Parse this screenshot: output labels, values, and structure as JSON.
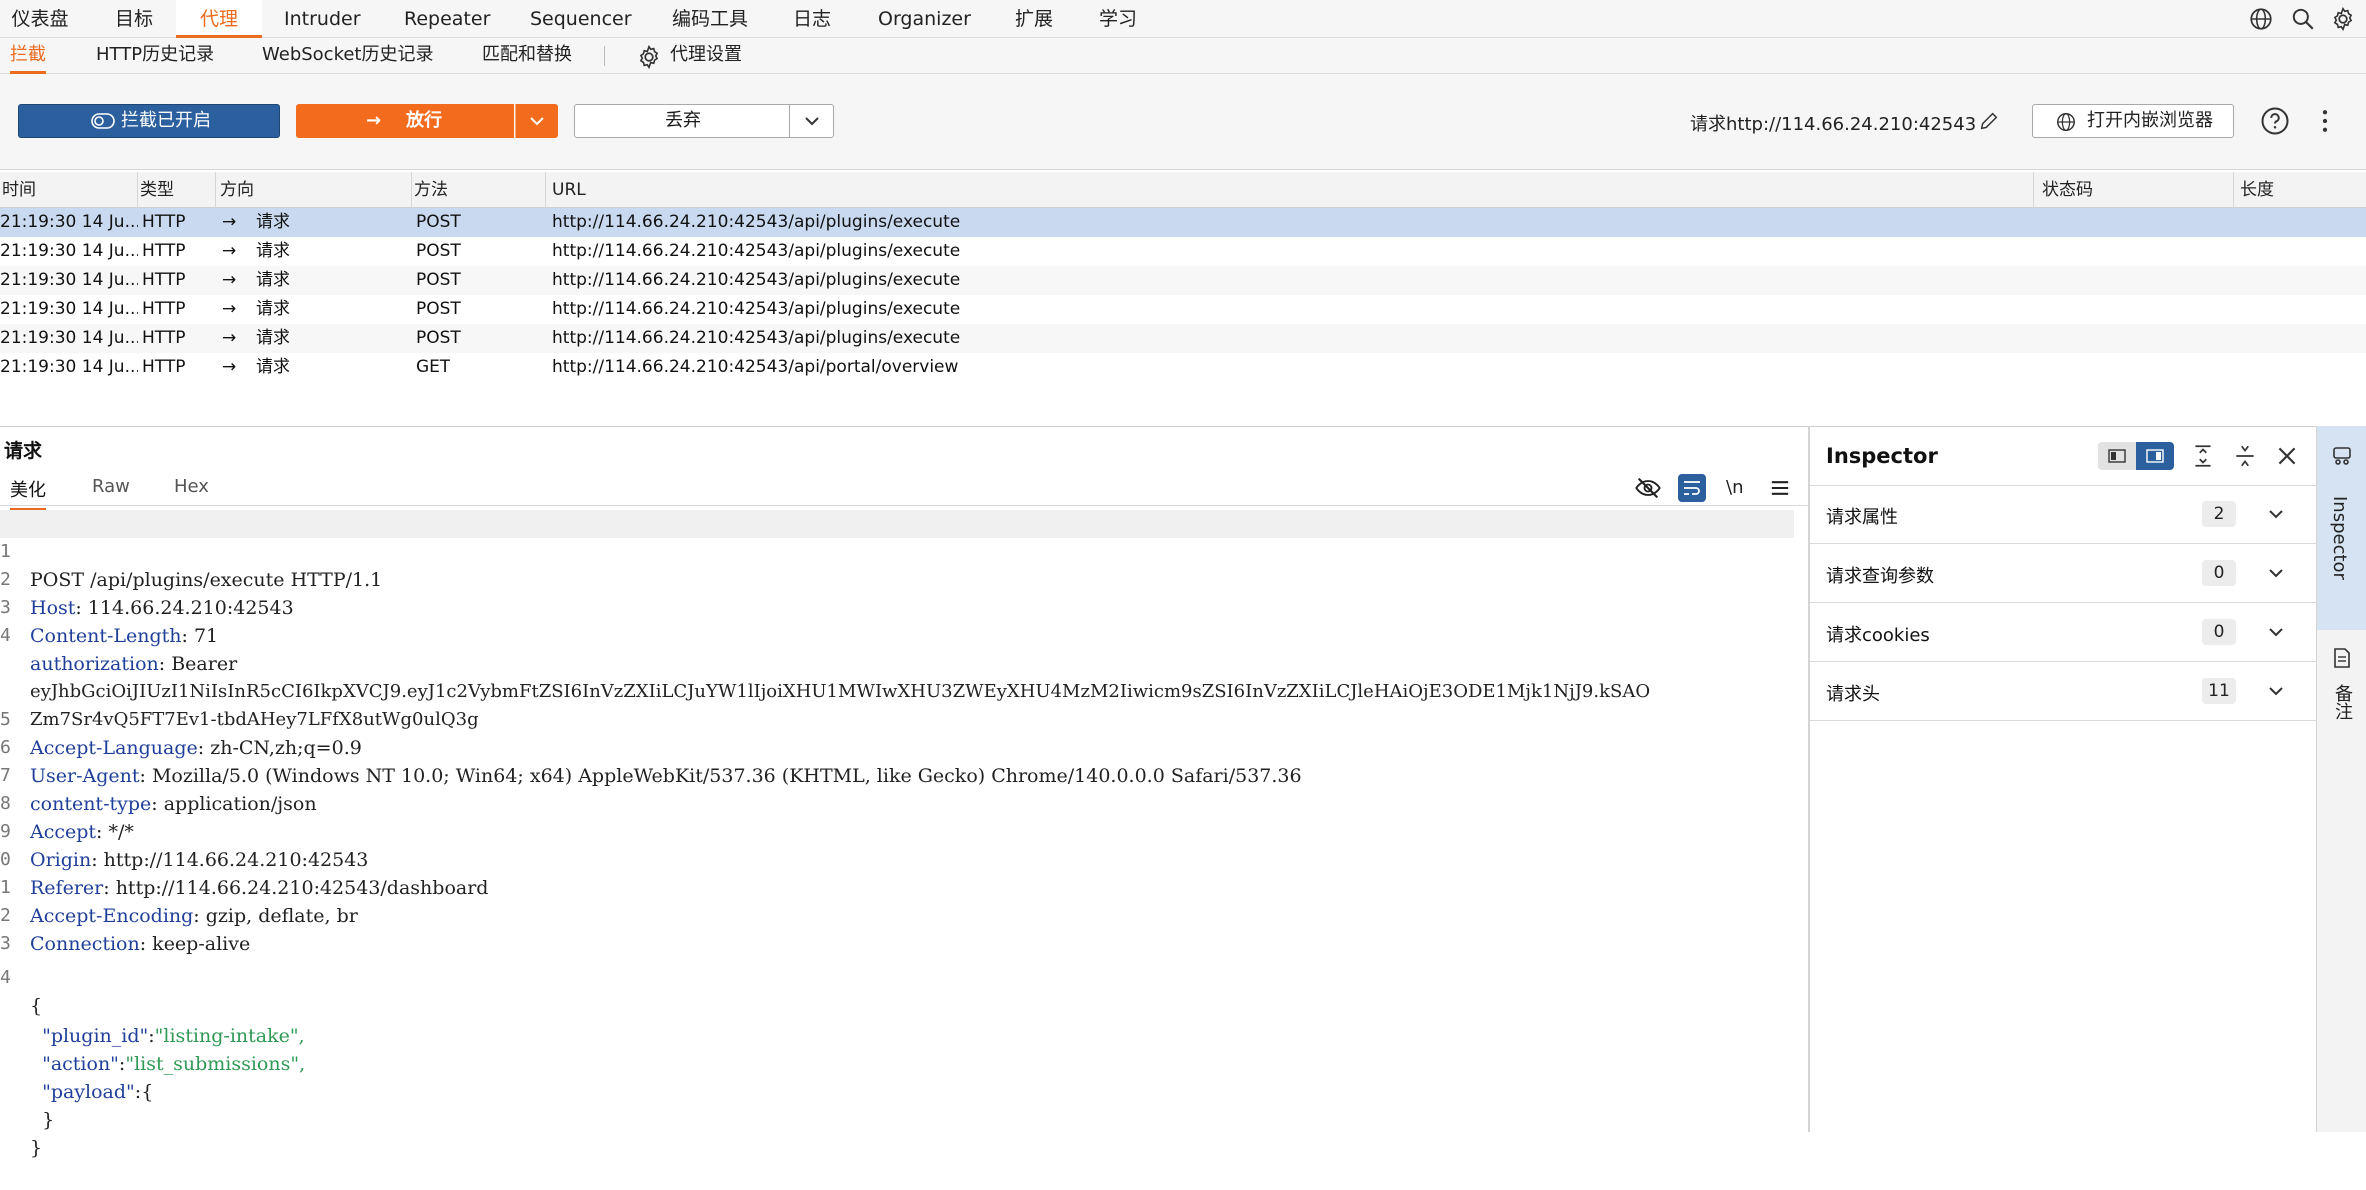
{
  "menu": {
    "items": [
      "仪表盘",
      "目标",
      "代理",
      "Intruder",
      "Repeater",
      "Sequencer",
      "编码工具",
      "日志",
      "Organizer",
      "扩展",
      "学习"
    ],
    "active": "代理"
  },
  "subtabs": {
    "items": [
      "拦截",
      "HTTP历史记录",
      "WebSocket历史记录",
      "匹配和替换"
    ],
    "settings": "代理设置"
  },
  "toolbar": {
    "intercept": "拦截已开启",
    "forward": "放行",
    "drop": "丢弃",
    "target": "请求http://114.66.24.210:42543",
    "browser": "打开内嵌浏览器"
  },
  "table": {
    "headers": [
      "时间",
      "类型",
      "方向",
      "方法",
      "URL",
      "状态码",
      "长度"
    ],
    "rows": [
      {
        "time": "21:19:30 14 Ju...",
        "type": "HTTP",
        "dir": "请求",
        "method": "POST",
        "url": "http://114.66.24.210:42543/api/plugins/execute"
      },
      {
        "time": "21:19:30 14 Ju...",
        "type": "HTTP",
        "dir": "请求",
        "method": "POST",
        "url": "http://114.66.24.210:42543/api/plugins/execute"
      },
      {
        "time": "21:19:30 14 Ju...",
        "type": "HTTP",
        "dir": "请求",
        "method": "POST",
        "url": "http://114.66.24.210:42543/api/plugins/execute"
      },
      {
        "time": "21:19:30 14 Ju...",
        "type": "HTTP",
        "dir": "请求",
        "method": "POST",
        "url": "http://114.66.24.210:42543/api/plugins/execute"
      },
      {
        "time": "21:19:30 14 Ju...",
        "type": "HTTP",
        "dir": "请求",
        "method": "POST",
        "url": "http://114.66.24.210:42543/api/plugins/execute"
      },
      {
        "time": "21:19:30 14 Ju...",
        "type": "HTTP",
        "dir": "请求",
        "method": "GET",
        "url": "http://114.66.24.210:42543/api/portal/overview"
      }
    ]
  },
  "request": {
    "title": "请求",
    "tabs": [
      "美化",
      "Raw",
      "Hex"
    ],
    "wrap_toggle": "\\n",
    "lines": [
      {
        "no": "1",
        "key": "",
        "val": "POST /api/plugins/execute HTTP/1.1"
      },
      {
        "no": "2",
        "key": "Host",
        "val": ": 114.66.24.210:42543"
      },
      {
        "no": "3",
        "key": "Content-Length",
        "val": ": 71"
      },
      {
        "no": "4",
        "key": "authorization",
        "val": ": Bearer"
      },
      {
        "no": "",
        "key": "",
        "val": "eyJhbGciOiJIUzI1NiIsInR5cCI6IkpXVCJ9.eyJ1c2VybmFtZSI6InVzZXIiLCJuYW1lIjoiXHU1MWIwXHU3ZWEyXHU4MzM2Iiwicm9sZSI6InVzZXIiLCJleHAiOjE3ODE1Mjk1NjJ9.kSAO"
      },
      {
        "no": "",
        "key": "",
        "val": "Zm7Sr4vQ5FT7Ev1-tbdAHey7LFfX8utWg0ulQ3g"
      },
      {
        "no": "5",
        "key": "Accept-Language",
        "val": ": zh-CN,zh;q=0.9"
      },
      {
        "no": "6",
        "key": "User-Agent",
        "val": ": Mozilla/5.0 (Windows NT 10.0; Win64; x64) AppleWebKit/537.36 (KHTML, like Gecko) Chrome/140.0.0.0 Safari/537.36"
      },
      {
        "no": "7",
        "key": "content-type",
        "val": ": application/json"
      },
      {
        "no": "8",
        "key": "Accept",
        "val": ": */*"
      },
      {
        "no": "9",
        "key": "Origin",
        "val": ": http://114.66.24.210:42543"
      },
      {
        "no": "0",
        "key": "Referer",
        "val": ": http://114.66.24.210:42543/dashboard"
      },
      {
        "no": "1",
        "key": "Accept-Encoding",
        "val": ": gzip, deflate, br"
      },
      {
        "no": "2",
        "key": "Connection",
        "val": ": keep-alive"
      },
      {
        "no": "3",
        "key": "",
        "val": ""
      },
      {
        "no": "4",
        "key": "",
        "val": "{"
      },
      {
        "no": "",
        "key": "  \"plugin_id\"",
        "val": ":",
        "str": "\"listing-intake\","
      },
      {
        "no": "",
        "key": "  \"action\"",
        "val": ":",
        "str": "\"list_submissions\","
      },
      {
        "no": "",
        "key": "  \"payload\"",
        "val": ":{"
      },
      {
        "no": "",
        "key": "",
        "val": "  }"
      },
      {
        "no": "",
        "key": "",
        "val": "}"
      }
    ]
  },
  "inspector": {
    "title": "Inspector",
    "sections": [
      {
        "label": "请求属性",
        "count": "2"
      },
      {
        "label": "请求查询参数",
        "count": "0"
      },
      {
        "label": "请求cookies",
        "count": "0"
      },
      {
        "label": "请求头",
        "count": "11"
      }
    ]
  },
  "sidebar": {
    "inspector": "Inspector",
    "notes": "备注"
  },
  "colors": {
    "accent": "#ec6b1f",
    "intercept_btn": "#2b5f9e",
    "forward_btn": "#f36b1c",
    "selected_row": "#c9d9ef",
    "header_key": "#1f3f9b",
    "json_string": "#2f9a55"
  }
}
